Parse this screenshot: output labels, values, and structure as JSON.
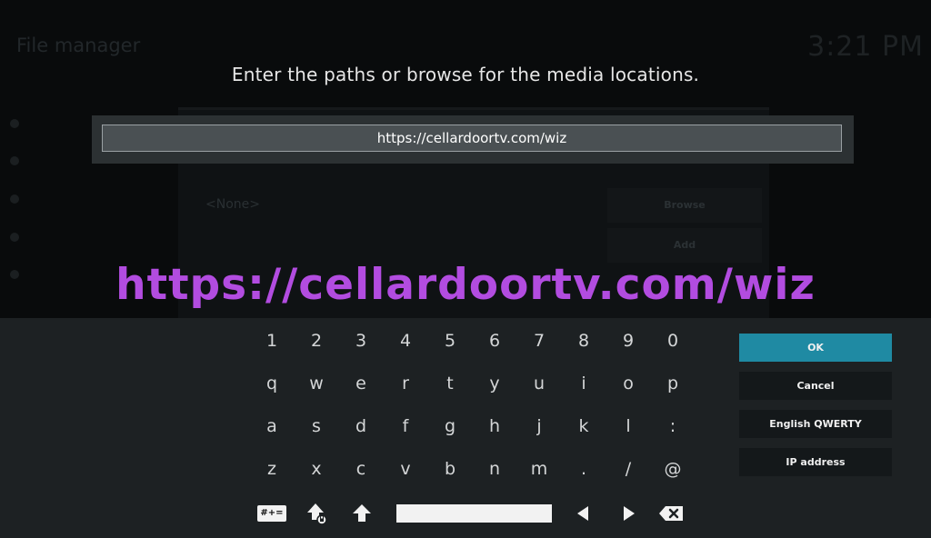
{
  "background": {
    "title": "File manager",
    "clock": "3:21 PM",
    "source_value": "<None>",
    "browse_label": "Browse",
    "add_label": "Add"
  },
  "dialog": {
    "heading": "Enter the paths or browse for the media locations.",
    "input_value": "https://cellardoortv.com/wiz"
  },
  "overlay": {
    "text": "https://cellardoortv.com/wiz",
    "color": "#b24ce0"
  },
  "keyboard": {
    "rows": [
      [
        "1",
        "2",
        "3",
        "4",
        "5",
        "6",
        "7",
        "8",
        "9",
        "0"
      ],
      [
        "q",
        "w",
        "e",
        "r",
        "t",
        "y",
        "u",
        "i",
        "o",
        "p"
      ],
      [
        "a",
        "s",
        "d",
        "f",
        "g",
        "h",
        "j",
        "k",
        "l",
        ":"
      ],
      [
        "z",
        "x",
        "c",
        "v",
        "b",
        "n",
        "m",
        ".",
        "/",
        "@"
      ]
    ],
    "symbols_key": "#+=",
    "icons": {
      "caps_lock": "caps-lock-icon",
      "shift": "shift-icon",
      "left": "arrow-left-icon",
      "right": "arrow-right-icon",
      "backspace": "backspace-icon"
    },
    "side_buttons": {
      "ok": "OK",
      "cancel": "Cancel",
      "layout": "English QWERTY",
      "ip": "IP address"
    },
    "accent_color": "#1f8aa3"
  }
}
